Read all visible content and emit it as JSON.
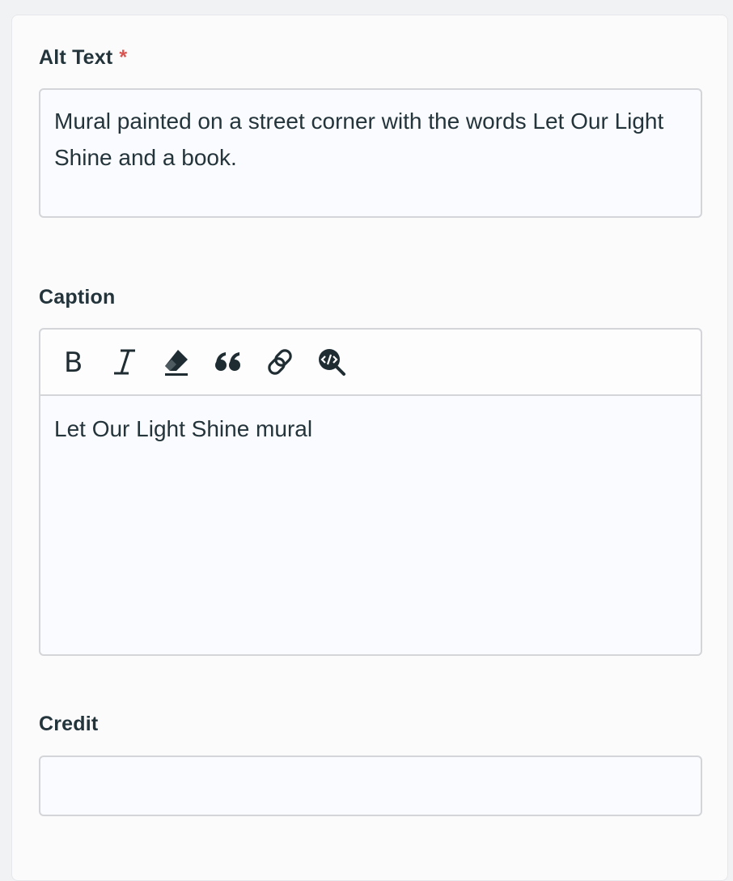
{
  "alt_text": {
    "label": "Alt Text",
    "required_marker": "*",
    "value": "Mural painted on a street corner with the words Let Our Light Shine and a book."
  },
  "caption": {
    "label": "Caption",
    "toolbar": [
      {
        "name": "bold-icon",
        "glyph": "B"
      },
      {
        "name": "italic-icon",
        "glyph": "I"
      },
      {
        "name": "eraser-icon"
      },
      {
        "name": "quote-icon"
      },
      {
        "name": "link-icon"
      },
      {
        "name": "code-search-icon"
      }
    ],
    "value": "Let Our Light Shine mural"
  },
  "credit": {
    "label": "Credit",
    "value": ""
  },
  "colors": {
    "required": "#d9534f",
    "text": "#24343b",
    "border": "#d3d5d9"
  }
}
